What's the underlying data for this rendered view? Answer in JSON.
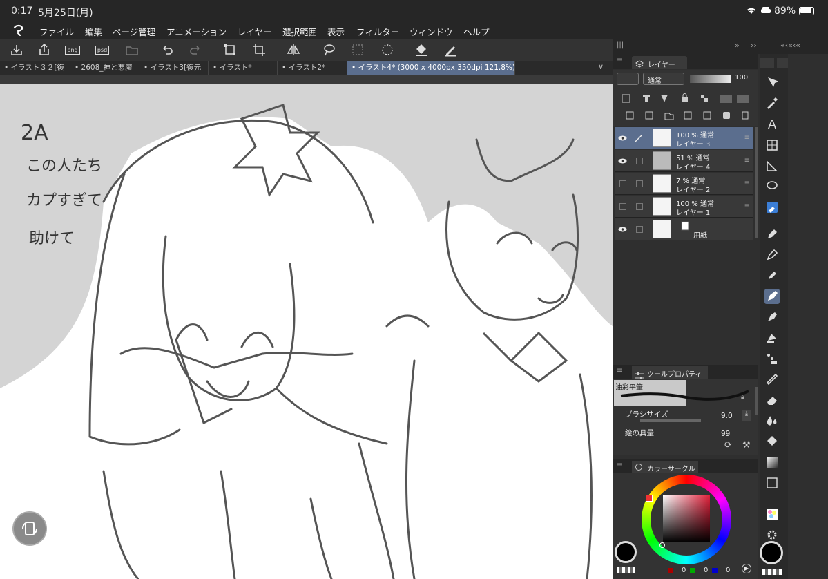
{
  "status": {
    "time": "0:17",
    "date": "5月25日(月)",
    "battery": "89%"
  },
  "menu": [
    "ファイル",
    "編集",
    "ページ管理",
    "アニメーション",
    "レイヤー",
    "選択範囲",
    "表示",
    "フィルター",
    "ウィンドウ",
    "ヘルプ"
  ],
  "toolbar_icons": [
    "save-icon",
    "export-icon",
    "png-export-icon",
    "psd-export-icon",
    "open-folder-icon",
    "undo-icon",
    "redo-icon",
    "transform-icon",
    "crop-icon",
    "flip-horizontal-icon",
    "lasso-icon",
    "select-all-icon",
    "deselect-icon",
    "fill-icon",
    "pen-icon"
  ],
  "toolbar_labels": {
    "png": "png",
    "psd": "psd"
  },
  "tabs": [
    "イラスト３２[復",
    "2608_神と悪魔",
    "イラスト3[復元",
    "イラスト*",
    "イラスト2*",
    "イラスト4* (3000 x 4000px 350dpi 121.8%)"
  ],
  "layer_panel": {
    "title": "レイヤー",
    "blend": "通常",
    "opacity": "100"
  },
  "layers": [
    {
      "pct": "100 %  通常",
      "name": "レイヤー 3",
      "selected": true,
      "visible": true
    },
    {
      "pct": "51 %  通常",
      "name": "レイヤー 4",
      "selected": false,
      "visible": true
    },
    {
      "pct": "7 %  通常",
      "name": "レイヤー 2",
      "selected": false,
      "visible": false
    },
    {
      "pct": "100 %  通常",
      "name": "レイヤー 1",
      "selected": false,
      "visible": false
    },
    {
      "pct": "",
      "name": "用紙",
      "selected": false,
      "visible": true
    }
  ],
  "tool_property": {
    "title": "ツールプロパティ",
    "brush": "油彩平筆",
    "size_label": "ブラシサイズ",
    "size_value": "9.0",
    "paint_label": "絵の具量",
    "paint_value": "99"
  },
  "color_circle": {
    "title": "カラーサークル",
    "r": "0",
    "g": "0",
    "b": "0"
  },
  "canvas_text": {
    "line1": "2A",
    "line2": "この人たち",
    "line3": "カプすぎて",
    "line4": "助けて"
  },
  "colors": {
    "accent": "#5b6e8e",
    "canvas": "#d4d4d4"
  }
}
